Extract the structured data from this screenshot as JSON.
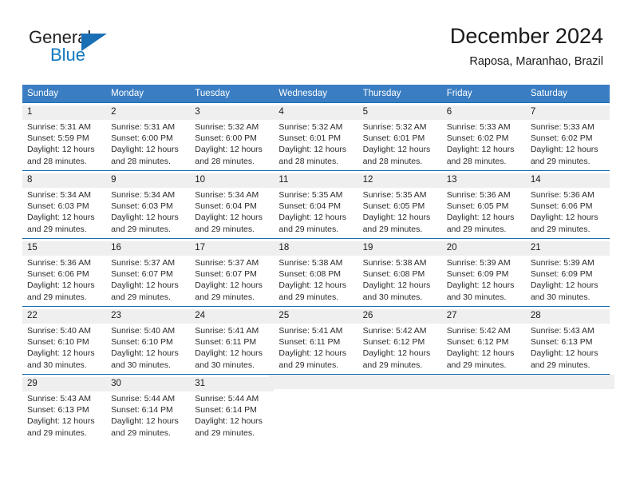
{
  "brand": {
    "name_part1": "General",
    "name_part2": "Blue",
    "logo_icon": "triangle-flag-icon"
  },
  "header": {
    "title": "December 2024",
    "subtitle": "Raposa, Maranhao, Brazil"
  },
  "colors": {
    "header_row": "#3a7dc2",
    "grid_line": "#1a6fb5",
    "daynum_bg": "#efefef",
    "brand_blue": "#1278be"
  },
  "weekday_headers": [
    "Sunday",
    "Monday",
    "Tuesday",
    "Wednesday",
    "Thursday",
    "Friday",
    "Saturday"
  ],
  "weeks": [
    [
      {
        "day": "1",
        "sunrise": "Sunrise: 5:31 AM",
        "sunset": "Sunset: 5:59 PM",
        "daylight1": "Daylight: 12 hours",
        "daylight2": "and 28 minutes."
      },
      {
        "day": "2",
        "sunrise": "Sunrise: 5:31 AM",
        "sunset": "Sunset: 6:00 PM",
        "daylight1": "Daylight: 12 hours",
        "daylight2": "and 28 minutes."
      },
      {
        "day": "3",
        "sunrise": "Sunrise: 5:32 AM",
        "sunset": "Sunset: 6:00 PM",
        "daylight1": "Daylight: 12 hours",
        "daylight2": "and 28 minutes."
      },
      {
        "day": "4",
        "sunrise": "Sunrise: 5:32 AM",
        "sunset": "Sunset: 6:01 PM",
        "daylight1": "Daylight: 12 hours",
        "daylight2": "and 28 minutes."
      },
      {
        "day": "5",
        "sunrise": "Sunrise: 5:32 AM",
        "sunset": "Sunset: 6:01 PM",
        "daylight1": "Daylight: 12 hours",
        "daylight2": "and 28 minutes."
      },
      {
        "day": "6",
        "sunrise": "Sunrise: 5:33 AM",
        "sunset": "Sunset: 6:02 PM",
        "daylight1": "Daylight: 12 hours",
        "daylight2": "and 28 minutes."
      },
      {
        "day": "7",
        "sunrise": "Sunrise: 5:33 AM",
        "sunset": "Sunset: 6:02 PM",
        "daylight1": "Daylight: 12 hours",
        "daylight2": "and 29 minutes."
      }
    ],
    [
      {
        "day": "8",
        "sunrise": "Sunrise: 5:34 AM",
        "sunset": "Sunset: 6:03 PM",
        "daylight1": "Daylight: 12 hours",
        "daylight2": "and 29 minutes."
      },
      {
        "day": "9",
        "sunrise": "Sunrise: 5:34 AM",
        "sunset": "Sunset: 6:03 PM",
        "daylight1": "Daylight: 12 hours",
        "daylight2": "and 29 minutes."
      },
      {
        "day": "10",
        "sunrise": "Sunrise: 5:34 AM",
        "sunset": "Sunset: 6:04 PM",
        "daylight1": "Daylight: 12 hours",
        "daylight2": "and 29 minutes."
      },
      {
        "day": "11",
        "sunrise": "Sunrise: 5:35 AM",
        "sunset": "Sunset: 6:04 PM",
        "daylight1": "Daylight: 12 hours",
        "daylight2": "and 29 minutes."
      },
      {
        "day": "12",
        "sunrise": "Sunrise: 5:35 AM",
        "sunset": "Sunset: 6:05 PM",
        "daylight1": "Daylight: 12 hours",
        "daylight2": "and 29 minutes."
      },
      {
        "day": "13",
        "sunrise": "Sunrise: 5:36 AM",
        "sunset": "Sunset: 6:05 PM",
        "daylight1": "Daylight: 12 hours",
        "daylight2": "and 29 minutes."
      },
      {
        "day": "14",
        "sunrise": "Sunrise: 5:36 AM",
        "sunset": "Sunset: 6:06 PM",
        "daylight1": "Daylight: 12 hours",
        "daylight2": "and 29 minutes."
      }
    ],
    [
      {
        "day": "15",
        "sunrise": "Sunrise: 5:36 AM",
        "sunset": "Sunset: 6:06 PM",
        "daylight1": "Daylight: 12 hours",
        "daylight2": "and 29 minutes."
      },
      {
        "day": "16",
        "sunrise": "Sunrise: 5:37 AM",
        "sunset": "Sunset: 6:07 PM",
        "daylight1": "Daylight: 12 hours",
        "daylight2": "and 29 minutes."
      },
      {
        "day": "17",
        "sunrise": "Sunrise: 5:37 AM",
        "sunset": "Sunset: 6:07 PM",
        "daylight1": "Daylight: 12 hours",
        "daylight2": "and 29 minutes."
      },
      {
        "day": "18",
        "sunrise": "Sunrise: 5:38 AM",
        "sunset": "Sunset: 6:08 PM",
        "daylight1": "Daylight: 12 hours",
        "daylight2": "and 29 minutes."
      },
      {
        "day": "19",
        "sunrise": "Sunrise: 5:38 AM",
        "sunset": "Sunset: 6:08 PM",
        "daylight1": "Daylight: 12 hours",
        "daylight2": "and 30 minutes."
      },
      {
        "day": "20",
        "sunrise": "Sunrise: 5:39 AM",
        "sunset": "Sunset: 6:09 PM",
        "daylight1": "Daylight: 12 hours",
        "daylight2": "and 30 minutes."
      },
      {
        "day": "21",
        "sunrise": "Sunrise: 5:39 AM",
        "sunset": "Sunset: 6:09 PM",
        "daylight1": "Daylight: 12 hours",
        "daylight2": "and 30 minutes."
      }
    ],
    [
      {
        "day": "22",
        "sunrise": "Sunrise: 5:40 AM",
        "sunset": "Sunset: 6:10 PM",
        "daylight1": "Daylight: 12 hours",
        "daylight2": "and 30 minutes."
      },
      {
        "day": "23",
        "sunrise": "Sunrise: 5:40 AM",
        "sunset": "Sunset: 6:10 PM",
        "daylight1": "Daylight: 12 hours",
        "daylight2": "and 30 minutes."
      },
      {
        "day": "24",
        "sunrise": "Sunrise: 5:41 AM",
        "sunset": "Sunset: 6:11 PM",
        "daylight1": "Daylight: 12 hours",
        "daylight2": "and 30 minutes."
      },
      {
        "day": "25",
        "sunrise": "Sunrise: 5:41 AM",
        "sunset": "Sunset: 6:11 PM",
        "daylight1": "Daylight: 12 hours",
        "daylight2": "and 29 minutes."
      },
      {
        "day": "26",
        "sunrise": "Sunrise: 5:42 AM",
        "sunset": "Sunset: 6:12 PM",
        "daylight1": "Daylight: 12 hours",
        "daylight2": "and 29 minutes."
      },
      {
        "day": "27",
        "sunrise": "Sunrise: 5:42 AM",
        "sunset": "Sunset: 6:12 PM",
        "daylight1": "Daylight: 12 hours",
        "daylight2": "and 29 minutes."
      },
      {
        "day": "28",
        "sunrise": "Sunrise: 5:43 AM",
        "sunset": "Sunset: 6:13 PM",
        "daylight1": "Daylight: 12 hours",
        "daylight2": "and 29 minutes."
      }
    ],
    [
      {
        "day": "29",
        "sunrise": "Sunrise: 5:43 AM",
        "sunset": "Sunset: 6:13 PM",
        "daylight1": "Daylight: 12 hours",
        "daylight2": "and 29 minutes."
      },
      {
        "day": "30",
        "sunrise": "Sunrise: 5:44 AM",
        "sunset": "Sunset: 6:14 PM",
        "daylight1": "Daylight: 12 hours",
        "daylight2": "and 29 minutes."
      },
      {
        "day": "31",
        "sunrise": "Sunrise: 5:44 AM",
        "sunset": "Sunset: 6:14 PM",
        "daylight1": "Daylight: 12 hours",
        "daylight2": "and 29 minutes."
      },
      {
        "day": "",
        "sunrise": "",
        "sunset": "",
        "daylight1": "",
        "daylight2": ""
      },
      {
        "day": "",
        "sunrise": "",
        "sunset": "",
        "daylight1": "",
        "daylight2": ""
      },
      {
        "day": "",
        "sunrise": "",
        "sunset": "",
        "daylight1": "",
        "daylight2": ""
      },
      {
        "day": "",
        "sunrise": "",
        "sunset": "",
        "daylight1": "",
        "daylight2": ""
      }
    ]
  ]
}
